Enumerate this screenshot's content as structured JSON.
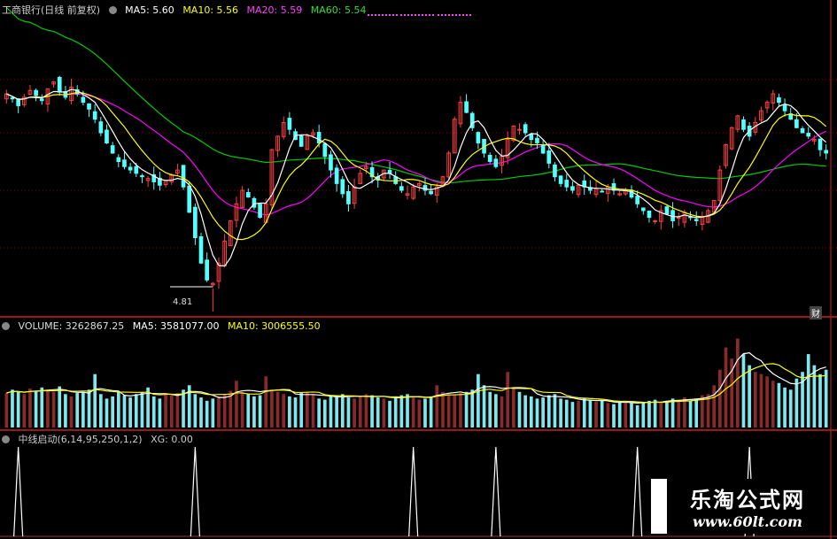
{
  "header": {
    "title": "工商银行(日线 前复权)",
    "ma5": "MA5: 5.60",
    "ma10": "MA10: 5.56",
    "ma20": "MA20: 5.59",
    "ma60": "MA60: 5.54"
  },
  "volume_header": {
    "label": "VOLUME: 3262867.25",
    "ma5": "MA5: 3581077.00",
    "ma10": "MA10: 3006555.50"
  },
  "indicator_header": {
    "label": "中线启动(6,14,95,250,1,2)",
    "xg": "XG: 0.00"
  },
  "annotations": {
    "low_price": "4.81",
    "fin_badge": "财"
  },
  "watermark": {
    "line1": "乐淘公式网",
    "line2": "www.60lt.com"
  },
  "colors": {
    "up": "#ff4040",
    "down": "#54ffff",
    "ma5": "#ffffff",
    "ma10": "#ffff00",
    "ma20": "#ff00ff",
    "ma60": "#00cc00",
    "grid": "#8b0000"
  },
  "chart_data": {
    "type": "candlestick",
    "price_range": [
      4.7,
      6.4
    ],
    "low_point": 4.81,
    "closes": [
      5.95,
      5.92,
      5.88,
      5.93,
      5.97,
      5.94,
      5.91,
      5.98,
      6.02,
      5.96,
      5.93,
      5.99,
      5.95,
      5.9,
      5.86,
      5.8,
      5.72,
      5.66,
      5.6,
      5.55,
      5.52,
      5.5,
      5.48,
      5.46,
      5.45,
      5.43,
      5.41,
      5.44,
      5.47,
      5.5,
      5.4,
      5.25,
      5.1,
      4.95,
      4.85,
      4.83,
      4.95,
      5.08,
      5.2,
      5.3,
      5.38,
      5.34,
      5.28,
      5.22,
      5.3,
      5.62,
      5.7,
      5.78,
      5.74,
      5.68,
      5.64,
      5.7,
      5.72,
      5.66,
      5.58,
      5.5,
      5.42,
      5.36,
      5.3,
      5.4,
      5.48,
      5.52,
      5.46,
      5.44,
      5.5,
      5.48,
      5.42,
      5.38,
      5.36,
      5.4,
      5.42,
      5.38,
      5.36,
      5.4,
      5.46,
      5.6,
      5.8,
      5.9,
      5.84,
      5.75,
      5.66,
      5.6,
      5.55,
      5.52,
      5.58,
      5.68,
      5.76,
      5.74,
      5.72,
      5.68,
      5.66,
      5.6,
      5.54,
      5.46,
      5.42,
      5.4,
      5.38,
      5.41,
      5.4,
      5.38,
      5.39,
      5.37,
      5.4,
      5.38,
      5.36,
      5.38,
      5.34,
      5.3,
      5.26,
      5.22,
      5.2,
      5.26,
      5.24,
      5.2,
      5.22,
      5.25,
      5.22,
      5.2,
      5.22,
      5.26,
      5.32,
      5.5,
      5.65,
      5.75,
      5.82,
      5.74,
      5.7,
      5.78,
      5.85,
      5.9,
      5.95,
      5.9,
      5.85,
      5.8,
      5.75,
      5.72,
      5.7,
      5.68,
      5.62,
      5.6
    ],
    "volume": [
      1.55,
      1.7,
      1.6,
      1.5,
      1.75,
      1.65,
      1.8,
      1.7,
      1.6,
      1.85,
      1.5,
      1.4,
      1.55,
      1.6,
      1.7,
      2.4,
      1.5,
      1.3,
      1.4,
      1.6,
      1.45,
      1.35,
      1.5,
      1.6,
      1.8,
      1.4,
      1.3,
      1.5,
      1.45,
      1.55,
      1.7,
      1.9,
      1.5,
      1.35,
      1.2,
      1.3,
      1.4,
      1.5,
      1.65,
      2.1,
      1.6,
      1.5,
      1.4,
      1.45,
      2.3,
      1.7,
      1.6,
      1.5,
      1.4,
      1.35,
      1.55,
      1.6,
      1.5,
      1.3,
      1.25,
      1.4,
      1.45,
      1.5,
      1.35,
      1.3,
      1.4,
      1.5,
      1.45,
      1.35,
      1.3,
      1.2,
      1.4,
      1.45,
      1.5,
      1.35,
      1.25,
      1.3,
      1.4,
      1.9,
      1.6,
      1.5,
      1.45,
      1.55,
      1.6,
      1.7,
      2.4,
      1.9,
      1.6,
      1.5,
      1.4,
      2.5,
      1.8,
      1.6,
      1.45,
      1.4,
      1.3,
      1.35,
      1.45,
      1.5,
      1.3,
      1.25,
      1.15,
      1.2,
      1.3,
      1.25,
      1.15,
      1.2,
      1.1,
      1.05,
      1.15,
      1.2,
      1.1,
      1.0,
      1.15,
      1.2,
      1.25,
      1.1,
      1.2,
      1.3,
      1.25,
      1.35,
      1.2,
      1.3,
      1.45,
      1.5,
      1.9,
      2.6,
      3.6,
      3.1,
      4.0,
      3.3,
      2.8,
      2.5,
      2.4,
      2.3,
      2.1,
      2.0,
      1.8,
      1.7,
      2.2,
      2.5,
      3.3,
      2.8,
      2.4,
      2.6
    ],
    "signals": [
      2,
      32,
      69,
      83,
      107,
      126
    ],
    "volume_range": [
      0,
      4.3
    ]
  }
}
